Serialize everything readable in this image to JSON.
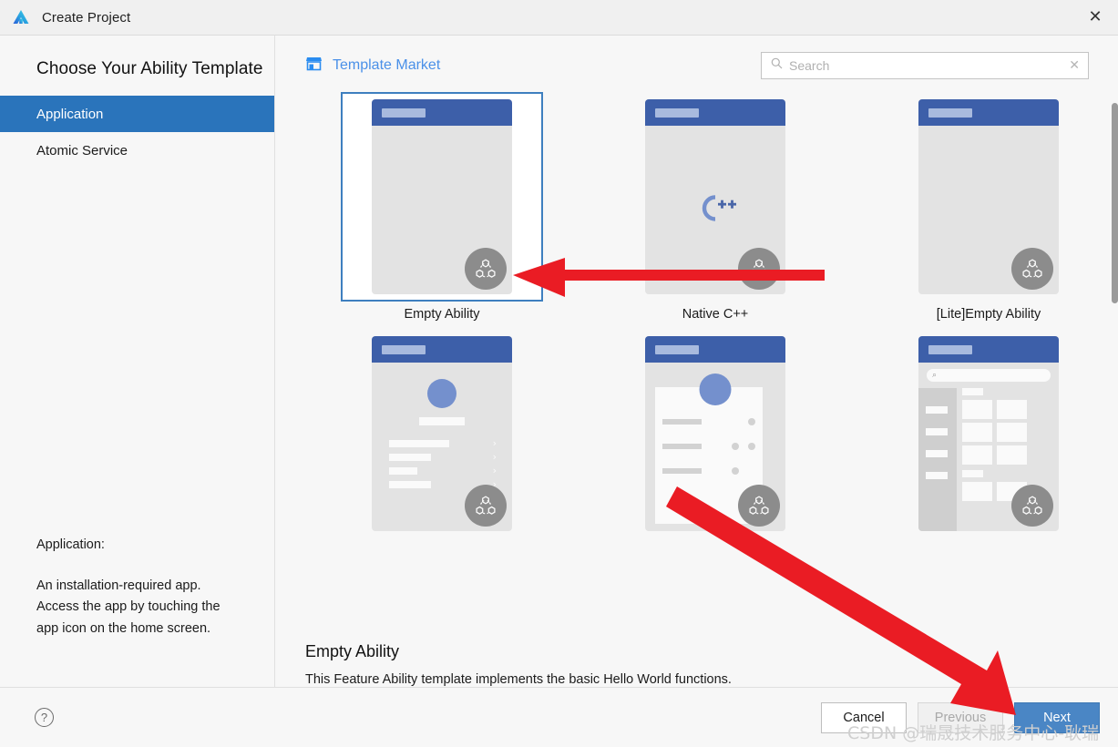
{
  "window": {
    "title": "Create Project",
    "logo_icon": "deveco-logo-icon",
    "close_icon": "✕"
  },
  "left": {
    "page_title": "Choose Your Ability Template",
    "categories": [
      {
        "label": "Application",
        "selected": true
      },
      {
        "label": "Atomic Service",
        "selected": false
      }
    ],
    "description_title": "Application:",
    "description_body": "An installation-required app.\nAccess the app by touching the\napp icon on the home screen."
  },
  "right": {
    "market_link": "Template Market",
    "market_icon": "store-icon",
    "search": {
      "placeholder": "Search",
      "value": "",
      "search_icon": "search-icon",
      "clear_icon": "✕"
    },
    "templates": [
      {
        "label": "Empty Ability",
        "preview": "blank",
        "selected": true
      },
      {
        "label": "Native C++",
        "preview": "cpp",
        "selected": false
      },
      {
        "label": "[Lite]Empty Ability",
        "preview": "blank",
        "selected": false
      },
      {
        "label": "",
        "preview": "profile-list",
        "selected": false
      },
      {
        "label": "",
        "preview": "card-list",
        "selected": false
      },
      {
        "label": "",
        "preview": "catalog-grid",
        "selected": false
      }
    ],
    "selected_detail": {
      "title": "Empty Ability",
      "text": "This Feature Ability template implements the basic Hello World functions."
    }
  },
  "footer": {
    "help_icon": "?",
    "buttons": [
      {
        "label": "Cancel",
        "style": "default",
        "disabled": false
      },
      {
        "label": "Previous",
        "style": "default",
        "disabled": true
      },
      {
        "label": "Next",
        "style": "primary",
        "disabled": false
      }
    ]
  },
  "annotations": {
    "arrow_1": "red-arrow-pointing-to-empty-ability-template",
    "arrow_2": "red-arrow-pointing-to-next-button"
  },
  "watermark": "CSDN @瑞晟技术服务中心-耿瑞",
  "colors": {
    "accent_blue": "#2a74bb",
    "primary_button": "#4a86c5",
    "link_blue": "#4a90e8",
    "annotation_red": "#ea1c24",
    "selection_border": "#3e7fbf"
  }
}
